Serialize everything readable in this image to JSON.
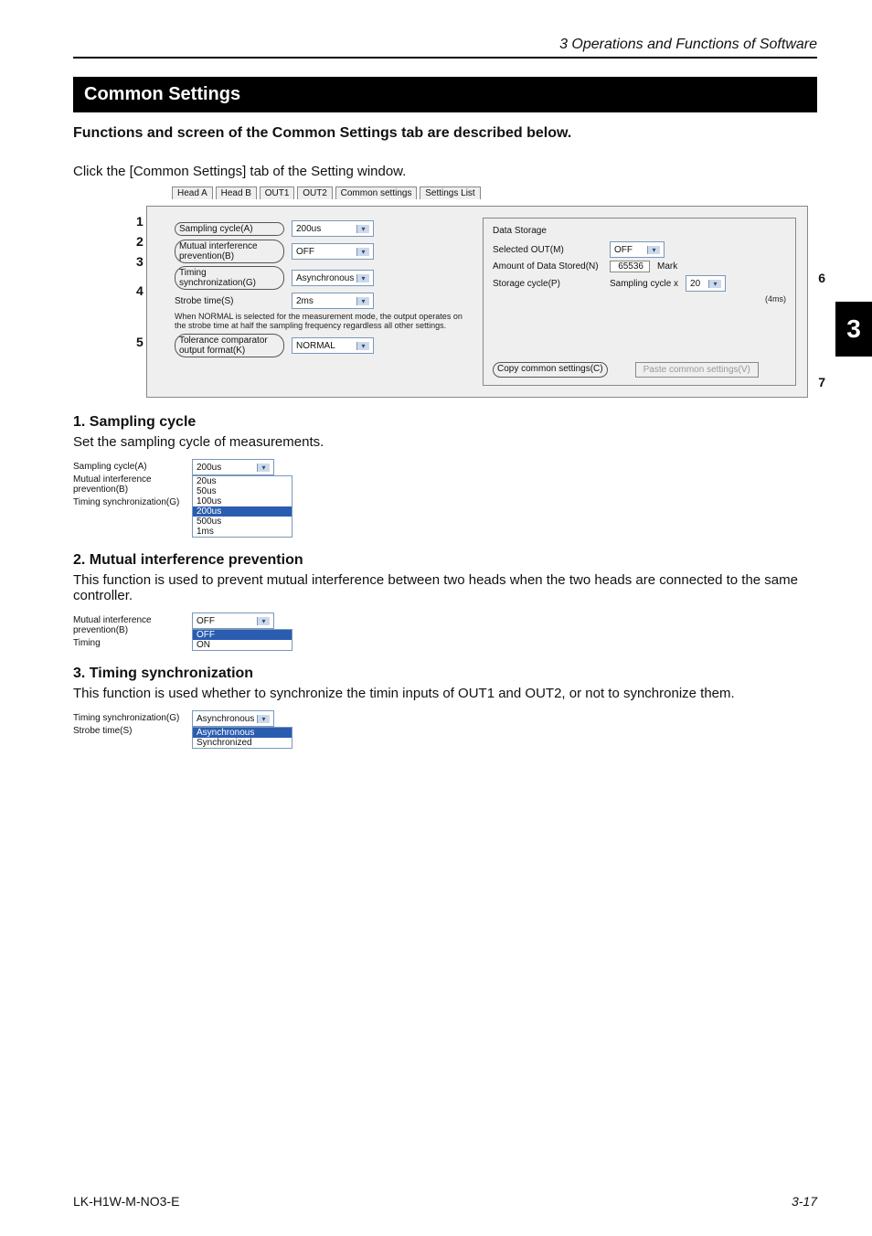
{
  "running_head": "3  Operations and Functions of Software",
  "side_tab": "3",
  "title": "Common Settings",
  "lead": "Functions and screen of the Common Settings tab are described below.",
  "intro": "Click the [Common Settings] tab of the Setting window.",
  "tabs": [
    "Head A",
    "Head B",
    "OUT1",
    "OUT2",
    "Common settings",
    "Settings List"
  ],
  "panel": {
    "sampling_label": "Sampling cycle(A)",
    "sampling_value": "200us",
    "mip_label": "Mutual interference prevention(B)",
    "mip_value": "OFF",
    "timing_label": "Timing synchronization(G)",
    "timing_value": "Asynchronous",
    "strobe_label": "Strobe time(S)",
    "strobe_value": "2ms",
    "strobe_note": "When NORMAL is selected for the measurement mode, the output operates on the strobe time at half the sampling frequency regardless all other settings.",
    "tol_label": "Tolerance comparator output format(K)",
    "tol_value": "NORMAL",
    "ds_heading": "Data Storage",
    "ds_selected_label": "Selected OUT(M)",
    "ds_selected_value": "OFF",
    "ds_amount_label": "Amount of Data Stored(N)",
    "ds_amount_value": "65536",
    "ds_amount_suffix": "Mark",
    "ds_cycle_label": "Storage cycle(P)",
    "ds_cycle_mid": "Sampling cycle x",
    "ds_cycle_value": "20",
    "ds_cycle_note": "(4ms)",
    "copy_btn": "Copy common settings(C)",
    "paste_btn": "Paste common settings(V)"
  },
  "callouts_left": [
    "1",
    "2",
    "3",
    "4",
    "5"
  ],
  "callouts_right": {
    "six": "6",
    "seven": "7"
  },
  "sections": {
    "s1_h": "1.   Sampling cycle",
    "s1_p": "Set the sampling cycle of measurements.",
    "s1_labels": [
      "Sampling cycle(A)",
      "Mutual interference prevention(B)",
      "Timing synchronization(G)"
    ],
    "s1_sel": "200us",
    "s1_list": [
      "20us",
      "50us",
      "100us",
      "200us",
      "500us",
      "1ms"
    ],
    "s2_h": "2.   Mutual interference prevention",
    "s2_p": "This function is used to prevent mutual interference between two heads when the two heads are connected to the same controller.",
    "s2_labels": [
      "Mutual interference prevention(B)",
      "Timing"
    ],
    "s2_sel": "OFF",
    "s2_list": [
      "OFF",
      "ON"
    ],
    "s3_h": "3.   Timing synchronization",
    "s3_p": "This function is used whether to synchronize the timin inputs of OUT1 and OUT2, or not to synchronize them.",
    "s3_labels": [
      "Timing synchronization(G)",
      "Strobe time(S)"
    ],
    "s3_sel": "Asynchronous",
    "s3_list": [
      "Asynchronous",
      "Synchronized"
    ]
  },
  "footer": {
    "left": "LK-H1W-M-NO3-E",
    "right": "3-17"
  }
}
